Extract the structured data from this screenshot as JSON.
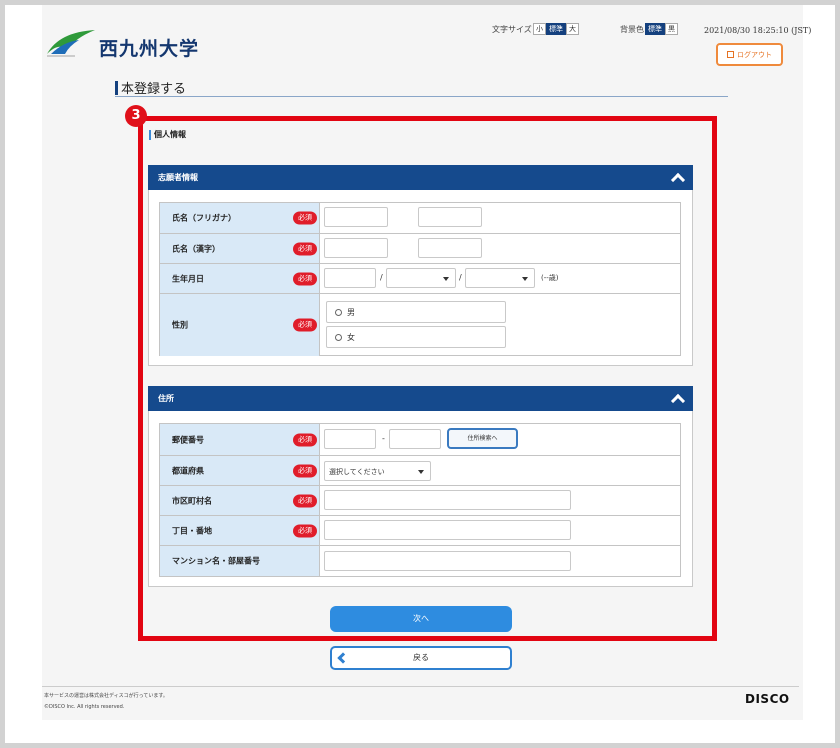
{
  "header": {
    "university": "西九州大学",
    "font_size_label": "文字サイズ",
    "font_sizes": [
      "小",
      "標準",
      "大"
    ],
    "bg_label": "背景色",
    "bg_options": [
      "標準",
      "黒"
    ],
    "datetime": "2021/08/30 18:25:10 (JST)",
    "logout": "ログアウト"
  },
  "page_title": "本登録する",
  "step_badge": "3",
  "section_title": "個人情報",
  "applicant": {
    "heading": "志願者情報",
    "required": "必須",
    "name_kana": "氏名（フリガナ）",
    "name_kanji": "氏名（漢字）",
    "birthdate": "生年月日",
    "slash": "/",
    "age": "(--歳)",
    "gender": "性別",
    "male": "男",
    "female": "女"
  },
  "address": {
    "heading": "住所",
    "postal": "郵便番号",
    "dash": "-",
    "search_btn": "住所検索へ",
    "prefecture": "都道府県",
    "prefecture_placeholder": "選択してください",
    "city": "市区町村名",
    "street": "丁目・番地",
    "building": "マンション名・部屋番号"
  },
  "next": "次へ",
  "back": "戻る",
  "footer": {
    "line1": "本サービスの運営は株式会社ディスコが行っています。",
    "line2": "©DISCO Inc. All rights reserved.",
    "brand": "DISCO"
  },
  "colors": {
    "navy": "#154a8d",
    "required_red": "#e01d2a",
    "highlight_red": "#e20512",
    "next_blue": "#2e8ce0",
    "label_bg": "#d9e9f7",
    "logout_orange": "#ef8a3c"
  }
}
